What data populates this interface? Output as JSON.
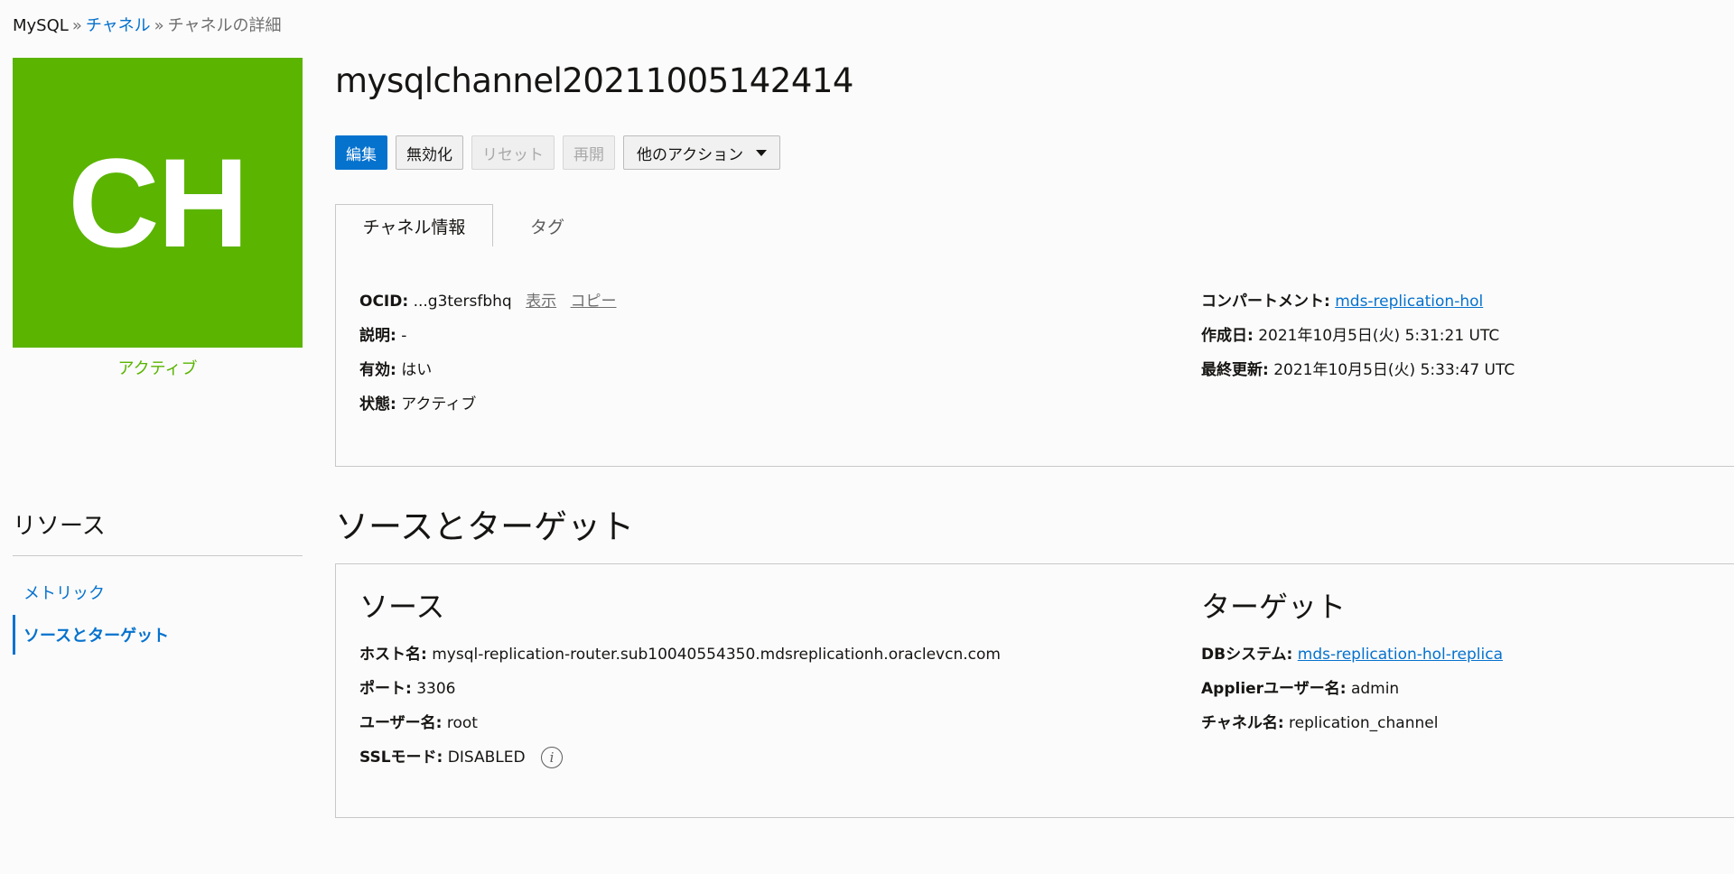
{
  "breadcrumb": {
    "root": "MySQL",
    "sep": "»",
    "parent": "チャネル",
    "current": "チャネルの詳細"
  },
  "badge": {
    "initials": "CH",
    "status": "アクティブ",
    "color": "#5ab400"
  },
  "title": "mysqlchannel20211005142414",
  "actions": {
    "edit": "編集",
    "disable": "無効化",
    "reset": "リセット",
    "resume": "再開",
    "more": "他のアクション"
  },
  "tabs": {
    "info": "チャネル情報",
    "tags": "タグ"
  },
  "info": {
    "ocid_label": "OCID:",
    "ocid_value": "...g3tersfbhq",
    "show": "表示",
    "copy": "コピー",
    "desc_label": "説明:",
    "desc_value": "-",
    "enabled_label": "有効:",
    "enabled_value": "はい",
    "state_label": "状態:",
    "state_value": "アクティブ",
    "compartment_label": "コンパートメント:",
    "compartment_value": "mds-replication-hol",
    "created_label": "作成日:",
    "created_value": "2021年10月5日(火) 5:31:21 UTC",
    "updated_label": "最終更新:",
    "updated_value": "2021年10月5日(火) 5:33:47 UTC"
  },
  "resources": {
    "title": "リソース",
    "items": [
      "メトリック",
      "ソースとターゲット"
    ]
  },
  "section": {
    "title": "ソースとターゲット",
    "source_title": "ソース",
    "target_title": "ターゲット",
    "host_label": "ホスト名:",
    "host_value": "mysql-replication-router.sub10040554350.mdsreplicationh.oraclevcn.com",
    "port_label": "ポート:",
    "port_value": "3306",
    "user_label": "ユーザー名:",
    "user_value": "root",
    "ssl_label": "SSLモード:",
    "ssl_value": "DISABLED",
    "db_label": "DBシステム:",
    "db_value": "mds-replication-hol-replica",
    "applier_label": "Applierユーザー名:",
    "applier_value": "admin",
    "channel_label": "チャネル名:",
    "channel_value": "replication_channel"
  },
  "colors": {
    "accent": "#0572ce",
    "active": "#5ab400"
  }
}
